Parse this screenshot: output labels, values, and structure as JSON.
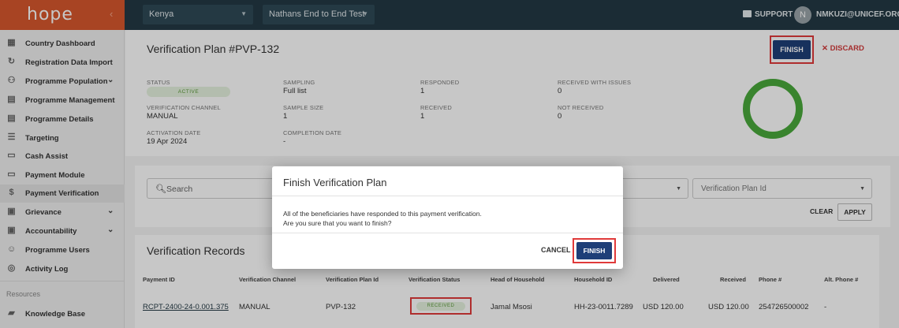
{
  "topbar": {
    "logo": "hope",
    "country": "Kenya",
    "programme": "Nathans End to End Test",
    "support_label": "SUPPORT",
    "avatar_initial": "N",
    "user_email": "NMKUZI@UNICEF.ORG"
  },
  "sidebar": {
    "items": [
      {
        "label": "Country Dashboard",
        "icon": "dashboard-icon"
      },
      {
        "label": "Registration Data Import",
        "icon": "refresh-icon"
      },
      {
        "label": "Programme Population",
        "icon": "people-icon"
      },
      {
        "label": "Programme Management",
        "icon": "clipboard-icon"
      },
      {
        "label": "Programme Details",
        "icon": "clipboard-icon"
      },
      {
        "label": "Targeting",
        "icon": "list-icon"
      },
      {
        "label": "Cash Assist",
        "icon": "card-icon"
      },
      {
        "label": "Payment Module",
        "icon": "card-icon"
      },
      {
        "label": "Payment Verification",
        "icon": "dollar-icon"
      },
      {
        "label": "Grievance",
        "icon": "alert-icon"
      },
      {
        "label": "Accountability",
        "icon": "forum-icon"
      },
      {
        "label": "Programme Users",
        "icon": "user-icon"
      },
      {
        "label": "Activity Log",
        "icon": "activity-icon"
      }
    ],
    "section_label": "Resources",
    "resources": [
      {
        "label": "Knowledge Base",
        "icon": "book-icon"
      }
    ]
  },
  "plan": {
    "title": "Verification Plan #PVP-132",
    "finish_label": "FINISH",
    "discard_label": "DISCARD",
    "fields": {
      "status_label": "STATUS",
      "status_value": "ACTIVE",
      "sampling_label": "SAMPLING",
      "sampling_value": "Full list",
      "responded_label": "RESPONDED",
      "responded_value": "1",
      "issues_label": "RECEIVED WITH ISSUES",
      "issues_value": "0",
      "channel_label": "VERIFICATION CHANNEL",
      "channel_value": "MANUAL",
      "sample_size_label": "SAMPLE SIZE",
      "sample_size_value": "1",
      "received_label": "RECEIVED",
      "received_value": "1",
      "not_received_label": "NOT RECEIVED",
      "not_received_value": "0",
      "activation_label": "ACTIVATION DATE",
      "activation_value": "19 Apr 2024",
      "completion_label": "COMPLETION DATE",
      "completion_value": "-"
    },
    "donut_color": "#4aa93b"
  },
  "filters": {
    "search_placeholder": "Search",
    "plan_id_placeholder": "Verification Plan Id",
    "clear_label": "CLEAR",
    "apply_label": "APPLY"
  },
  "records": {
    "title": "Verification Records",
    "headers": [
      "Payment ID",
      "Verification Channel",
      "Verification Plan Id",
      "Verification Status",
      "Head of Household",
      "Household ID",
      "Delivered",
      "Received",
      "Phone #",
      "Alt. Phone #"
    ],
    "rows": [
      [
        "RCPT-2400-24-0.001.375",
        "MANUAL",
        "PVP-132",
        "RECEIVED",
        "Jamal Msosi",
        "HH-23-0011.7289",
        "USD 120.00",
        "USD 120.00",
        "254726500002",
        "-"
      ]
    ]
  },
  "dialog": {
    "title": "Finish Verification Plan",
    "line1": "All of the beneficiaries have responded to this payment verification.",
    "line2": "Are you sure that you want to finish?",
    "cancel_label": "CANCEL",
    "finish_label": "FINISH"
  }
}
